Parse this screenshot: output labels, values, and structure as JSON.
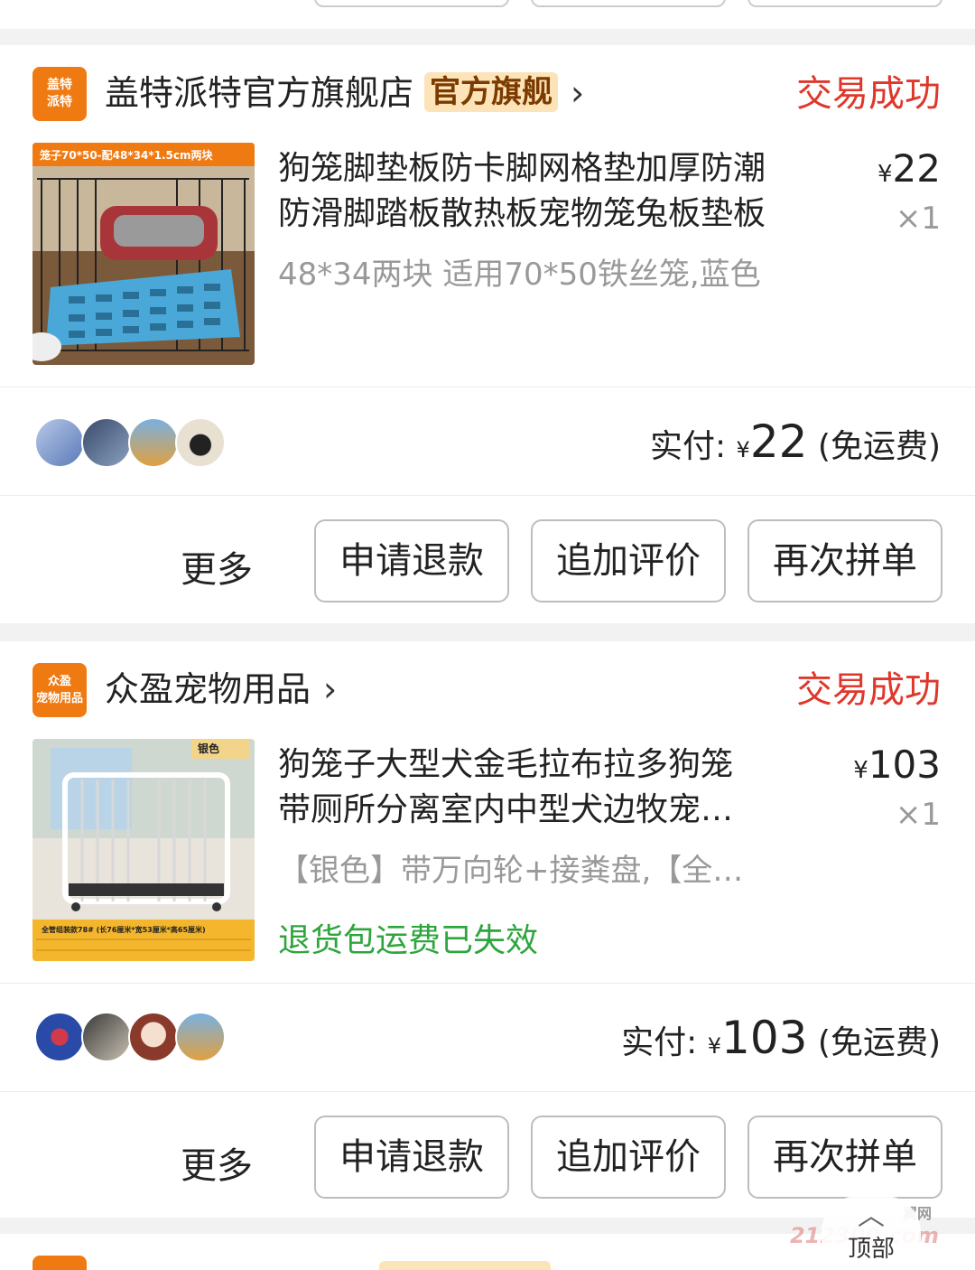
{
  "orders": [
    {
      "shop": {
        "logo_text": "盖特\n派特",
        "name": "盖特派特官方旗舰店",
        "badge": "官方旗舰",
        "status": "交易成功"
      },
      "product": {
        "image_banner": "笼子70*50-配48*34*1.5cm两块",
        "title": "狗笼脚垫板防卡脚网格垫加厚防潮防滑脚踏板散热板宠物笼兔板垫板",
        "title_line1": "狗笼脚垫板防卡脚网格垫加厚防潮",
        "title_line2": "防滑脚踏板散热板宠物笼兔板垫板",
        "price": "22",
        "qty": "×1",
        "spec": "48*34两块 适用70*50铁丝笼,蓝色"
      },
      "summary": {
        "label": "实付:",
        "yen": "¥",
        "amount": "22",
        "shipping": "(免运费)"
      },
      "actions": {
        "more": "更多",
        "refund": "申请退款",
        "review": "追加评价",
        "reorder": "再次拼单"
      }
    },
    {
      "shop": {
        "logo_text": "众盈\n宠物用品",
        "name": "众盈宠物用品",
        "status": "交易成功"
      },
      "product": {
        "image_tag": "银色",
        "image_caption": "全管组装款78# (长76厘米*宽53厘米*高65厘米)",
        "title_line1": "狗笼子大型犬金毛拉布拉多狗笼",
        "title_line2": "带厕所分离室内中型犬边牧宠…",
        "price": "103",
        "qty": "×1",
        "spec": "【银色】带万向轮+接粪盘,【全…",
        "refund_note": "退货包运费已失效"
      },
      "summary": {
        "label": "实付:",
        "yen": "¥",
        "amount": "103",
        "shipping": "(免运费)"
      },
      "actions": {
        "more": "更多",
        "refund": "申请退款",
        "review": "追加评价",
        "reorder": "再次拼单"
      }
    }
  ],
  "float_top": {
    "label": "顶部"
  },
  "watermark": {
    "text": "212300.com",
    "brand": "翼网"
  },
  "colors": {
    "success": "#e0372b",
    "shop_logo": "#f07a12",
    "badge_bg": "#fde3b8",
    "refund_note": "#2ea53d"
  },
  "icons": {
    "shop_chevron": "chevron-right-icon",
    "float": "chevron-up-icon"
  }
}
